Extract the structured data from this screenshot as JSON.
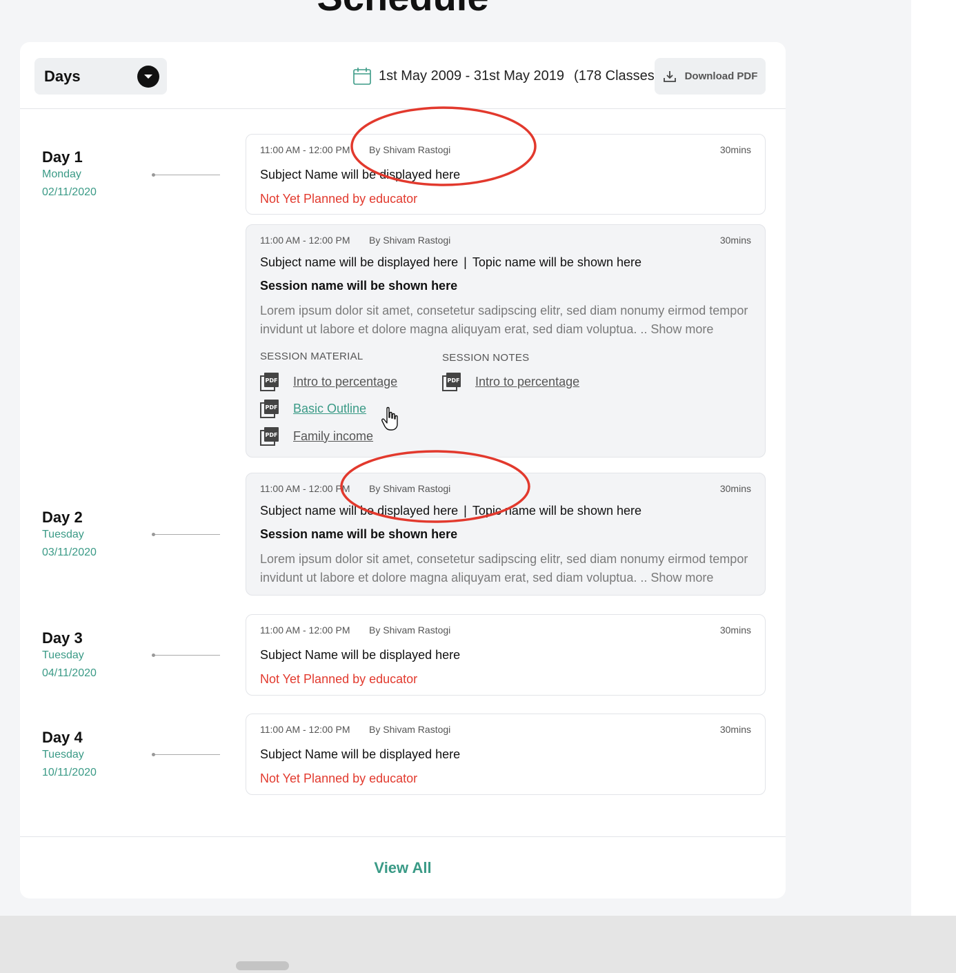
{
  "page": {
    "title": "Schedule"
  },
  "header": {
    "view_selector": "Days",
    "date_range": "1st May 2009 - 31st May 2019",
    "class_count": "(178 Classes)",
    "download_label": "Download PDF"
  },
  "days": [
    {
      "day": "Day 1",
      "weekday": "Monday",
      "date": "02/11/2020"
    },
    {
      "day": "Day 2",
      "weekday": "Tuesday",
      "date": "03/11/2020"
    },
    {
      "day": "Day 3",
      "weekday": "Tuesday",
      "date": "04/11/2020"
    },
    {
      "day": "Day 4",
      "weekday": "Tuesday",
      "date": "10/11/2020"
    }
  ],
  "sessions": [
    {
      "time": "11:00 AM - 12:00 PM",
      "by": "By  Shivam Rastogi",
      "duration": "30mins",
      "subject": "Subject Name will be displayed here",
      "status": "Not Yet Planned by educator"
    },
    {
      "time": "11:00 AM - 12:00 PM",
      "by": "By  Shivam Rastogi",
      "duration": "30mins",
      "subject": "Subject name will be displayed here",
      "separator": "|",
      "topic": "Topic name will be shown here",
      "session_name": "Session name will be shown here",
      "description": "Lorem ipsum dolor sit amet, consetetur sadipscing elitr, sed diam nonumy eirmod tempor invidunt ut labore et dolore magna aliquyam erat, sed diam voluptua. ..",
      "show_more": "Show more",
      "material_heading": "SESSION MATERIAL",
      "materials": [
        "Intro to percentage",
        "Basic Outline",
        "Family income"
      ],
      "notes_heading": "SESSION NOTES",
      "notes": [
        "Intro to percentage"
      ]
    },
    {
      "time": "11:00 AM - 12:00 PM",
      "by": "By  Shivam Rastogi",
      "duration": "30mins",
      "subject": "Subject name will be displayed here",
      "separator": "|",
      "topic": "Topic name will be shown here",
      "session_name": "Session name will be shown here",
      "description": "Lorem ipsum dolor sit amet, consetetur sadipscing elitr, sed diam nonumy eirmod tempor invidunt ut labore et dolore magna aliquyam erat, sed diam voluptua. ..",
      "show_more": "Show more"
    },
    {
      "time": "11:00 AM - 12:00 PM",
      "by": "By  Shivam Rastogi",
      "duration": "30mins",
      "subject": "Subject Name will be displayed here",
      "status": "Not Yet Planned by educator"
    },
    {
      "time": "11:00 AM - 12:00 PM",
      "by": "By  Shivam Rastogi",
      "duration": "30mins",
      "subject": "Subject Name will be displayed here",
      "status": "Not Yet Planned by educator"
    }
  ],
  "footer": {
    "view_all": "View All"
  },
  "colors": {
    "accent": "#3a9a86",
    "alert": "#e23a2e",
    "annotation": "#e2392d"
  },
  "icons": [
    "chevron-down-icon",
    "calendar-icon",
    "download-icon",
    "pdf-icon",
    "hand-cursor-icon"
  ]
}
